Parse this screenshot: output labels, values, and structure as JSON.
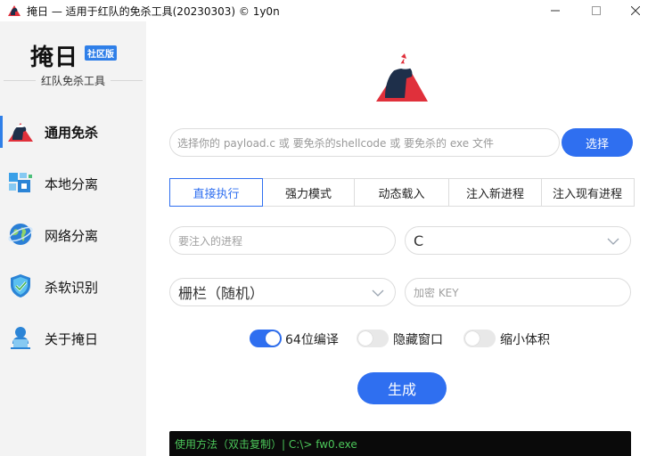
{
  "window": {
    "title": "掩日 — 适用于红队的免杀工具(20230303) © 1y0n",
    "minimize_glyph": "—",
    "maximize_glyph": "☐",
    "close_glyph": "✕"
  },
  "sidebar": {
    "brand_name": "掩日",
    "brand_badge": "社区版",
    "brand_subtitle": "红队免杀工具",
    "items": [
      {
        "label": "通用免杀",
        "icon": "wolf-icon",
        "active": true
      },
      {
        "label": "本地分离",
        "icon": "data-blocks-icon",
        "active": false
      },
      {
        "label": "网络分离",
        "icon": "globe-icon",
        "active": false
      },
      {
        "label": "杀软识别",
        "icon": "shield-check-icon",
        "active": false
      },
      {
        "label": "关于掩日",
        "icon": "user-laptop-icon",
        "active": false
      }
    ]
  },
  "main": {
    "path_input": {
      "placeholder": "选择你的 payload.c 或 要免杀的shellcode 或 要免杀的 exe 文件",
      "value": ""
    },
    "select_button": "选择",
    "tabs": [
      "直接执行",
      "强力模式",
      "动态载入",
      "注入新进程",
      "注入现有进程"
    ],
    "active_tab": 0,
    "process_input": {
      "placeholder": "要注入的进程",
      "value": ""
    },
    "language_select": {
      "value": "C"
    },
    "encrypt_select": {
      "value": "栅栏（随机）"
    },
    "key_input": {
      "placeholder": "加密 KEY",
      "value": ""
    },
    "toggles": [
      {
        "label": "64位编译",
        "on": true
      },
      {
        "label": "隐藏窗口",
        "on": false
      },
      {
        "label": "缩小体积",
        "on": false
      }
    ],
    "generate_button": "生成",
    "console_text": "使用方法（双击复制）| C:\\> fw0.exe"
  },
  "colors": {
    "accent": "#2f6ff0",
    "sidebar_bg": "#f3f3f3",
    "console_bg": "#0a0a0a",
    "console_text": "#4cc75a"
  }
}
